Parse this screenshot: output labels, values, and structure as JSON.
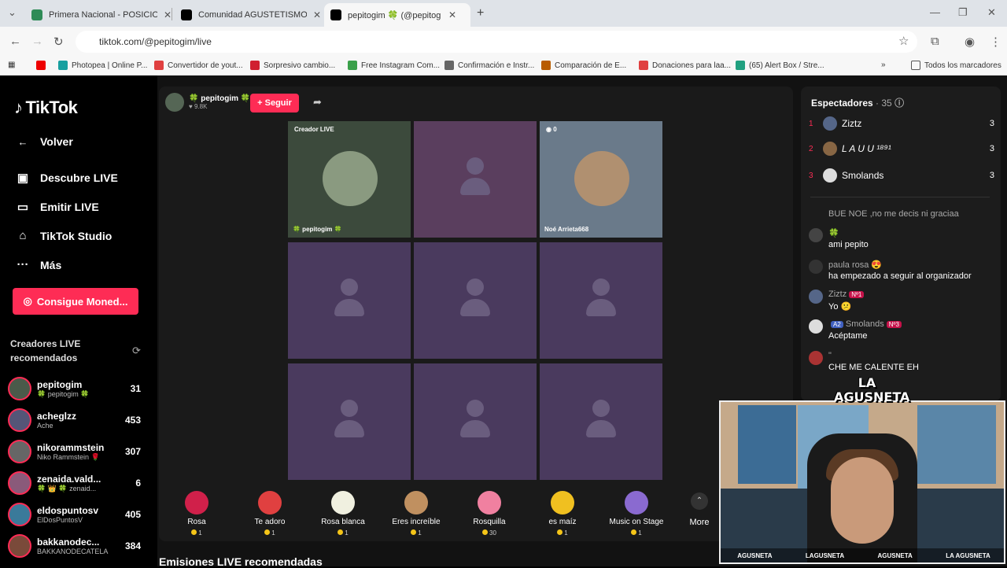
{
  "browser": {
    "tabs": [
      {
        "title": "Primera Nacional - POSICIONE",
        "color": "#2e8b57"
      },
      {
        "title": "Comunidad AGUSTETISMO (Su",
        "color": "#000000"
      },
      {
        "title": "pepitogim 🍀 (@pepitog",
        "color": "#000000"
      }
    ],
    "url": "tiktok.com/@pepitogim/live",
    "bookmarks": [
      {
        "label": "Photopea | Online P...",
        "color": "#18a0a0"
      },
      {
        "label": "Convertidor de yout...",
        "color": "#e04040"
      },
      {
        "label": "Sorpresivo cambio...",
        "color": "#d02030"
      },
      {
        "label": "Free Instagram Com...",
        "color": "#3aa04a"
      },
      {
        "label": "Confirmación e Instr...",
        "color": "#666666"
      },
      {
        "label": "Comparación de E...",
        "color": "#b85c00"
      },
      {
        "label": "Donaciones para laa...",
        "color": "#e04040"
      },
      {
        "label": "(65) Alert Box / Stre...",
        "color": "#20a080"
      }
    ],
    "all_bookmarks": "Todos los marcadores"
  },
  "sidebar": {
    "logo": "TikTok",
    "back": "Volver",
    "nav": [
      {
        "label": "Descubre LIVE",
        "icon": "discover-live-icon"
      },
      {
        "label": "Emitir LIVE",
        "icon": "camera-icon"
      },
      {
        "label": "TikTok Studio",
        "icon": "studio-icon"
      },
      {
        "label": "Más",
        "icon": "more-icon"
      }
    ],
    "coins_button": "Consigue Moned...",
    "recommended_title": "Creadores LIVE recomendados",
    "creators": [
      {
        "name": "pepitogim",
        "sub": "🍀 pepitogim 🍀",
        "count": "31",
        "color": "#4a5a4a"
      },
      {
        "name": "acheglzz",
        "sub": "Ache",
        "count": "453",
        "color": "#555577"
      },
      {
        "name": "nikorammstein",
        "sub": "Niko Rammstein 🌹",
        "count": "307",
        "color": "#666666"
      },
      {
        "name": "zenaida.vald...",
        "sub": "🍀 👑 🍀 zenaid...",
        "count": "6",
        "color": "#8a5a7a"
      },
      {
        "name": "eldospuntosv",
        "sub": "ElDosPuntosV",
        "count": "405",
        "color": "#3a7a9a"
      },
      {
        "name": "bakkanodec...",
        "sub": "BAKKANODECATELA",
        "count": "384",
        "color": "#7a4a3a"
      }
    ]
  },
  "live": {
    "host_name": "🍀 pepitogim 🍀",
    "host_likes": "♥ 9.8K",
    "follow": "+ Seguir",
    "creator_tag": "Creador LIVE",
    "host_label": "🍀 pepitogim 🍀",
    "guest_label": "Noé Arrieta668",
    "guest_badge": "◉ 0"
  },
  "gifts": [
    {
      "name": "Rosa",
      "price": "1",
      "color": "#d0204a"
    },
    {
      "name": "Te adoro",
      "price": "1",
      "color": "#e04040"
    },
    {
      "name": "Rosa blanca",
      "price": "1",
      "color": "#f0f0e0"
    },
    {
      "name": "Eres increíble",
      "price": "1",
      "color": "#c09060"
    },
    {
      "name": "Rosquilla",
      "price": "30",
      "color": "#f080a0"
    },
    {
      "name": "es maíz",
      "price": "1",
      "color": "#f0c020"
    },
    {
      "name": "Music on Stage",
      "price": "1",
      "color": "#8a6ad0"
    }
  ],
  "more_label": "More",
  "recommended_live": "Emisiones LIVE recomendadas",
  "chat": {
    "spectators_label": "Espectadores",
    "spectators_count": "· 35",
    "viewers": [
      {
        "rank": "1",
        "name": "Ziztz",
        "count": "3",
        "color": "#556688"
      },
      {
        "rank": "2",
        "name": "L A U U ¹⁸⁹¹",
        "count": "3",
        "color": "#886644"
      },
      {
        "rank": "3",
        "name": "Smolands",
        "count": "3",
        "color": "#dddddd"
      }
    ],
    "messages": [
      {
        "name": "",
        "text": "BUE NOE ,no me decis ni graciaa",
        "color": "#1c1c1c"
      },
      {
        "name": "🍀",
        "text": "ami pepito",
        "color": "#444444"
      },
      {
        "name": "paula rosa 😍",
        "text": "ha empezado a seguir al organizador",
        "color": "#333333"
      },
      {
        "name": "Ziztz",
        "text": "Yo 😕",
        "color": "#556688",
        "badge": "Nº1"
      },
      {
        "name": "Smolands",
        "text": "Acéptame",
        "color": "#dddddd",
        "badge": "Nº3",
        "level": "A2"
      },
      {
        "name": "\"",
        "text": "CHE ME CALENTE EH",
        "color": "#aa3333"
      }
    ]
  },
  "webcam": {
    "logo": "LA AGUSNETA",
    "footer": [
      "AGUSNETA",
      "LAGUSNETA",
      "AGUSNETA",
      "LA AGUSNETA"
    ]
  }
}
